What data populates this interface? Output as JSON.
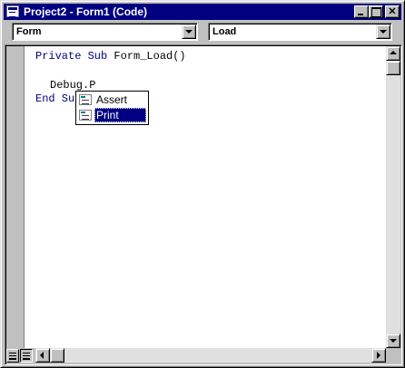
{
  "window": {
    "title": "Project2 - Form1 (Code)",
    "title_icon": "code-window-icon",
    "controls": {
      "minimize": "minimize-icon",
      "maximize": "maximize-icon",
      "close_glyph": "✕"
    }
  },
  "object_combo": {
    "value": "Form"
  },
  "procedure_combo": {
    "value": "Load"
  },
  "code": {
    "line_1": {
      "keyword": "Private Sub",
      "rest": " Form_Load()"
    },
    "line_2": {
      "text": "Debug.P"
    },
    "line_3": {
      "keyword": "End Su",
      "rest": ""
    }
  },
  "autocomplete": {
    "items": [
      {
        "label": "Assert",
        "icon": "method-icon",
        "selected": false
      },
      {
        "label": "Print",
        "icon": "method-icon",
        "selected": true
      }
    ]
  },
  "colors": {
    "titlebar": "#000080",
    "selection": "#000080",
    "chrome": "#c0c0c0",
    "keyword": "#00007f"
  }
}
